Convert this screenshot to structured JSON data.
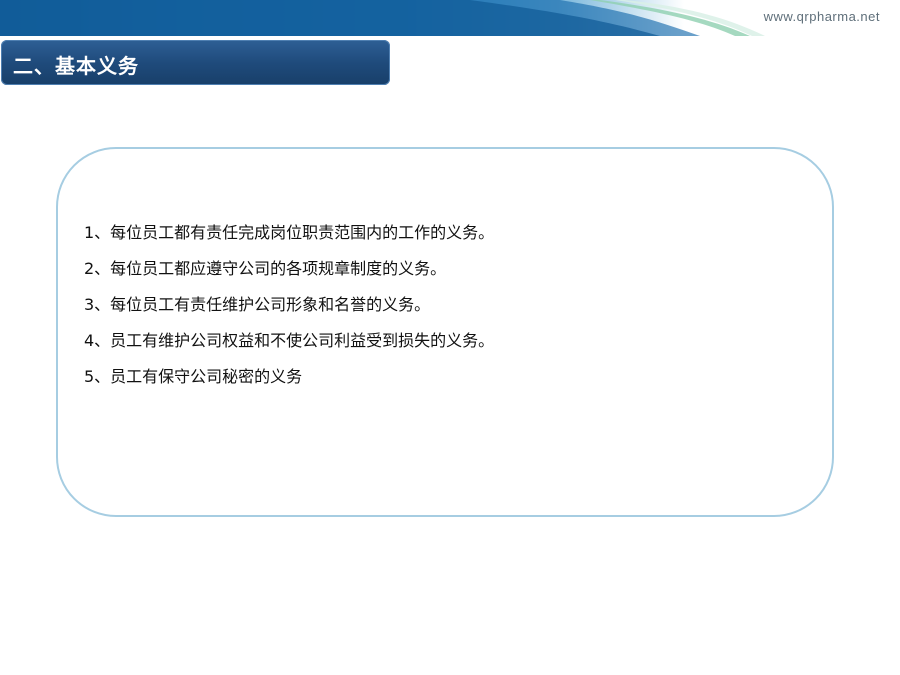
{
  "header": {
    "site_url": "www.qrpharma.net"
  },
  "section": {
    "title": "二、基本义务"
  },
  "duties": [
    "1、每位员工都有责任完成岗位职责范围内的工作的义务。",
    "2、每位员工都应遵守公司的各项规章制度的义务。",
    "3、每位员工有责任维护公司形象和名誉的义务。",
    "4、员工有维护公司权益和不使公司利益受到损失的义务。",
    "5、员工有保守公司秘密的义务"
  ],
  "colors": {
    "banner_dark": "#0c4f86",
    "banner_mid": "#2b88c7",
    "title_bar": "#1f4b7c",
    "box_border": "#a6cde2",
    "text": "#111111"
  }
}
